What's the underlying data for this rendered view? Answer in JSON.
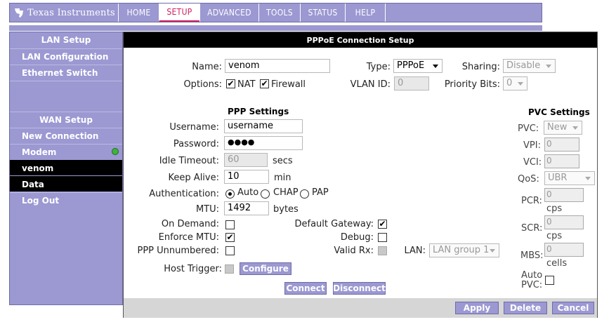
{
  "brand": {
    "logo_text": "Texas Instruments"
  },
  "nav": {
    "tabs": [
      {
        "label": "HOME"
      },
      {
        "label": "SETUP"
      },
      {
        "label": "ADVANCED"
      },
      {
        "label": "TOOLS"
      },
      {
        "label": "STATUS"
      },
      {
        "label": "HELP"
      }
    ],
    "active": "SETUP"
  },
  "sidebar": {
    "lan_header": "LAN Setup",
    "lan_items": [
      "LAN Configuration",
      "Ethernet Switch"
    ],
    "wan_header": "WAN Setup",
    "wan_items": [
      "New Connection",
      "Modem",
      "venom",
      "Data",
      "Log Out"
    ]
  },
  "panel": {
    "title": "PPPoE Connection Setup",
    "name_label": "Name:",
    "name_value": "venom",
    "type_label": "Type:",
    "type_value": "PPPoE",
    "sharing_label": "Sharing:",
    "sharing_value": "Disable",
    "options_label": "Options:",
    "nat_label": "NAT",
    "firewall_label": "Firewall",
    "vlan_label": "VLAN ID:",
    "vlan_value": "0",
    "priority_label": "Priority Bits:",
    "priority_value": "0"
  },
  "ppp": {
    "header": "PPP Settings",
    "username_label": "Username:",
    "username_value": "username",
    "password_label": "Password:",
    "password_value": "●●●●",
    "idle_label": "Idle Timeout:",
    "idle_value": "60",
    "idle_unit": "secs",
    "keepalive_label": "Keep Alive:",
    "keepalive_value": "10",
    "keepalive_unit": "min",
    "auth_label": "Authentication:",
    "auth_options": [
      "Auto",
      "CHAP",
      "PAP"
    ],
    "auth_selected": "Auto",
    "mtu_label": "MTU:",
    "mtu_value": "1492",
    "mtu_unit": "bytes",
    "on_demand_label": "On Demand:",
    "enforce_mtu_label": "Enforce MTU:",
    "ppp_unnumbered_label": "PPP Unnumbered:",
    "default_gw_label": "Default Gateway:",
    "debug_label": "Debug:",
    "valid_rx_label": "Valid Rx:",
    "lan_label": "LAN:",
    "lan_value": "LAN group 1",
    "host_trigger_label": "Host Trigger:",
    "configure_button": "Configure",
    "connect_button": "Connect",
    "disconnect_button": "Disconnect"
  },
  "pvc": {
    "header": "PVC Settings",
    "pvc_label": "PVC:",
    "pvc_value": "New",
    "vpi_label": "VPI:",
    "vpi_value": "0",
    "vci_label": "VCI:",
    "vci_value": "0",
    "qos_label": "QoS:",
    "qos_value": "UBR",
    "pcr_label": "PCR:",
    "pcr_value": "0",
    "pcr_unit": "cps",
    "scr_label": "SCR:",
    "scr_value": "0",
    "scr_unit": "cps",
    "mbs_label": "MBS:",
    "mbs_value": "0",
    "mbs_unit": "cells",
    "auto_pvc_label_1": "Auto",
    "auto_pvc_label_2": "PVC:"
  },
  "footer": {
    "apply": "Apply",
    "delete": "Delete",
    "cancel": "Cancel"
  },
  "colors": {
    "accent": "#9b98d2",
    "active_tab_text": "#d02060",
    "status_dot": "#3cb43c"
  }
}
